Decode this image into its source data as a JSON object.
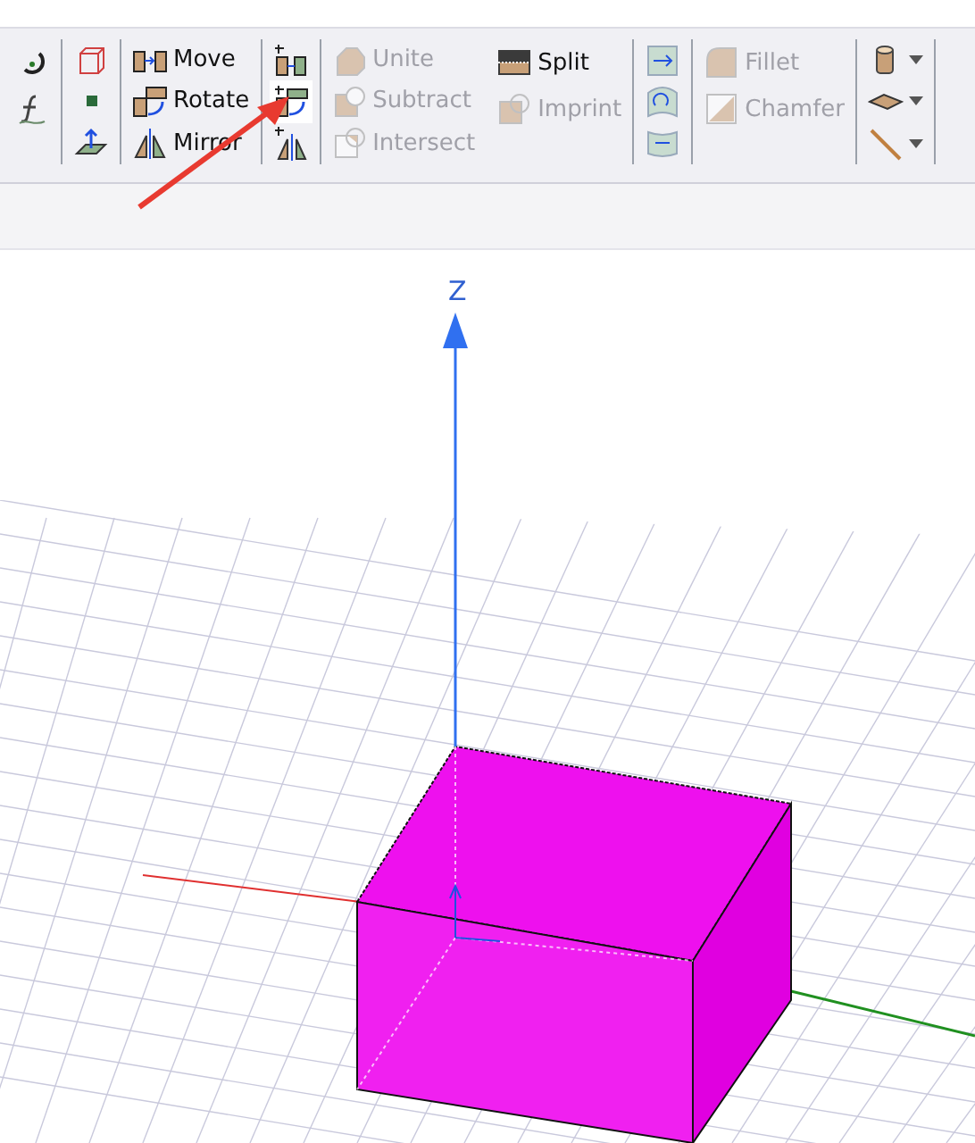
{
  "toolbar": {
    "groups": [
      {
        "items": [
          {
            "kind": "icon",
            "disabled": false,
            "selected": false
          },
          {
            "kind": "icon",
            "disabled": false,
            "selected": false
          }
        ]
      },
      {
        "items": [
          {
            "kind": "icon",
            "disabled": false,
            "selected": false
          },
          {
            "kind": "icon",
            "disabled": false,
            "selected": false
          },
          {
            "kind": "icon",
            "disabled": false,
            "selected": false
          }
        ]
      },
      {
        "items": [
          {
            "kind": "labeled",
            "label": "Move",
            "disabled": false,
            "selected": false
          },
          {
            "kind": "labeled",
            "label": "Rotate",
            "disabled": false,
            "selected": false
          },
          {
            "kind": "labeled",
            "label": "Mirror",
            "disabled": false,
            "selected": false
          }
        ]
      },
      {
        "items": [
          {
            "kind": "icon",
            "disabled": false,
            "selected": false
          },
          {
            "kind": "icon",
            "disabled": false,
            "selected": true
          },
          {
            "kind": "icon",
            "disabled": false,
            "selected": false
          }
        ]
      },
      {
        "items": [
          {
            "kind": "labeled",
            "label": "Unite",
            "disabled": true,
            "selected": false
          },
          {
            "kind": "labeled",
            "label": "Subtract",
            "disabled": true,
            "selected": false
          },
          {
            "kind": "labeled",
            "label": "Intersect",
            "disabled": true,
            "selected": false
          }
        ],
        "joined": true
      },
      {
        "items": [
          {
            "kind": "labeled",
            "label": "Split",
            "disabled": false,
            "selected": false
          },
          {
            "kind": "labeled",
            "label": "Imprint",
            "disabled": true,
            "selected": false
          }
        ]
      },
      {
        "items": [
          {
            "kind": "icon",
            "disabled": false,
            "selected": false
          },
          {
            "kind": "icon",
            "disabled": false,
            "selected": false
          },
          {
            "kind": "icon",
            "disabled": false,
            "selected": false
          }
        ]
      },
      {
        "items": [
          {
            "kind": "labeled",
            "label": "Fillet",
            "disabled": true,
            "selected": false
          },
          {
            "kind": "labeled",
            "label": "Chamfer",
            "disabled": true,
            "selected": false
          }
        ]
      },
      {
        "items": [
          {
            "kind": "dropdown",
            "disabled": false,
            "selected": false
          },
          {
            "kind": "dropdown",
            "disabled": false,
            "selected": false
          },
          {
            "kind": "dropdown",
            "disabled": false,
            "selected": false
          }
        ]
      }
    ]
  },
  "viewport": {
    "axis_label": "Z"
  }
}
